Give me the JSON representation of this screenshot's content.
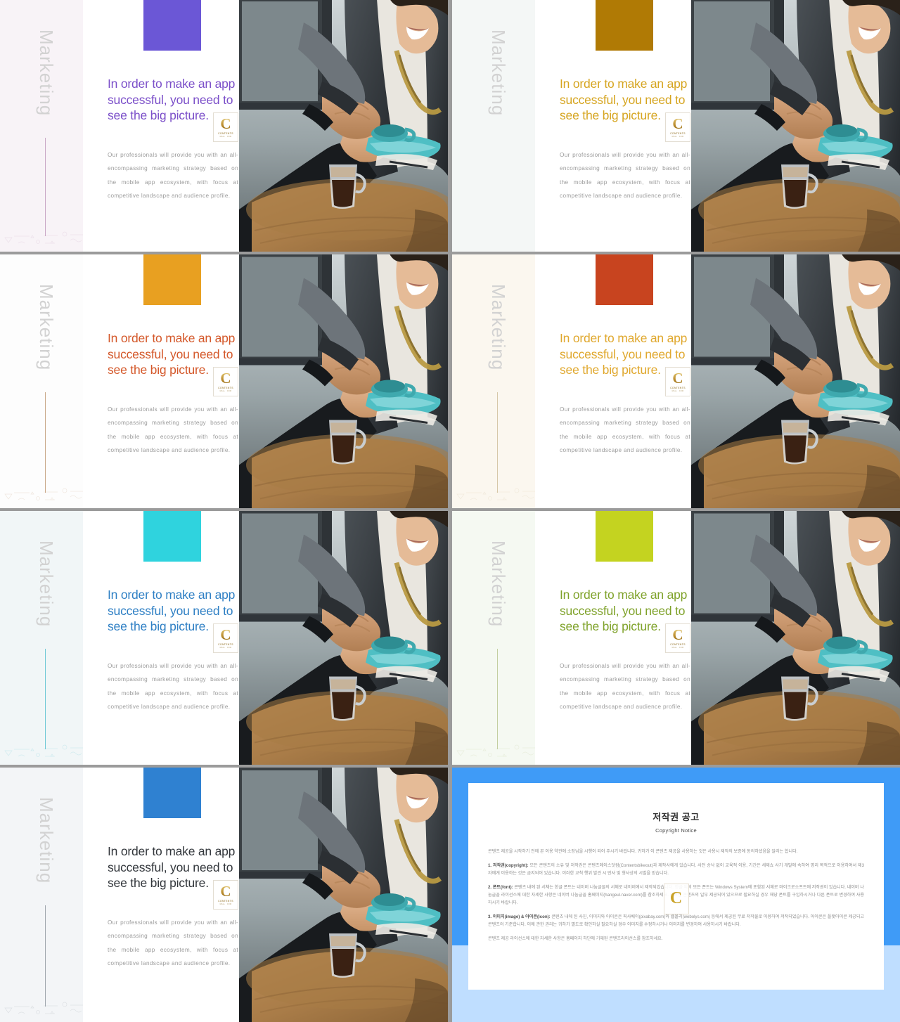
{
  "deck": {
    "slide_count": 8,
    "vertical_label": "Marketing",
    "headline": "In order to make an app successful,  you need to see the big picture.",
    "body": "Our professionals will provide you with an all-encompassing marketing strategy based on the mobile app ecosystem, with focus at competitive landscape and audience profile.",
    "logo": {
      "letter": "C",
      "name": "CONTENTS",
      "tagline": "MALL . COM"
    }
  },
  "slides": [
    {
      "index": 1,
      "accent_hex": "#6B57D6",
      "headline_hex": "#7B4FC9",
      "tint_hex": "#f8f3f7",
      "rule_hex": "#c9a8c6",
      "name": "slide-purple"
    },
    {
      "index": 2,
      "accent_hex": "#B07A05",
      "headline_hex": "#D6A520",
      "tint_hex": "#f4f7f6",
      "rule_hex": "#c7b municipality",
      "name": "slide-gold"
    },
    {
      "index": 3,
      "accent_hex": "#E8A021",
      "headline_hex": "#D4582A",
      "tint_hex": "#fdfdfd",
      "rule_hex": "#c9a98a",
      "name": "slide-orange"
    },
    {
      "index": 4,
      "accent_hex": "#C8441F",
      "headline_hex": "#E0A82E",
      "tint_hex": "#fbf7ef",
      "rule_hex": "#d6c8a8",
      "name": "slide-brick"
    },
    {
      "index": 5,
      "accent_hex": "#2FD3DE",
      "headline_hex": "#2E7FC4",
      "tint_hex": "#f1f6f7",
      "rule_hex": "#6fc9d6",
      "name": "slide-cyan"
    },
    {
      "index": 6,
      "accent_hex": "#C4D320",
      "headline_hex": "#7FA22A",
      "tint_hex": "#f5f9f2",
      "rule_hex": "#c3cfa0",
      "name": "slide-lime"
    },
    {
      "index": 7,
      "accent_hex": "#2F81D1",
      "headline_hex": "#33373C",
      "tint_hex": "#f3f5f7",
      "rule_hex": "#9fa6ad",
      "name": "slide-blue"
    }
  ],
  "copyright": {
    "title": "저작권 공고",
    "subtitle": "Copyright Notice",
    "intro": "콘텐츠 제공을 시작하기 전에 본 이용 약관에 소장님을 시행이 되어 주시기 바랍니다. 귀하가 이 콘텐츠 제공을 사용하는 것은 사용시 제작의 보증에 동의하셨음을 알리는 합니다.",
    "sections": [
      {
        "label": "1. 저작권(copyright):",
        "text": "모든 콘텐츠의 소유 및 저작권은 콘텐츠메이스닷컴(Contentsbikeout)과 제작사에게 있습니다. 사전 승낙 없이 교육적 이용, 기간은 세제쇼 사기 개발에 속하여 영리 목적으로 이용하여서 제3자에게 이용하는 것은 금지되어 있습니다. 이러한 교칙 행위 발견 시 민사 및 형사상의 시벌을 받습니다."
      },
      {
        "label": "2. 폰트(font):",
        "text": "콘텐츠 내에 된 서체는 한글 폰트는 네이버 나눔글꼴의 서체로 네이버에서 제작되었습니다. 한글 외의 모든 폰트는 Windows System에 포함된 서체로 마이크로소프트에 저작권이 있습니다. 네이버 나눔글꼴 라이선스에 대한 자세한 사항은 네이버 나눔글꼴 홈페이지(hangeul.naver.com)를 참조하세요. 폰트는 콘텐츠의 일부 제공되어 있으므로 필요하실 경우 해당 폰트를 구입하시거나 다른 폰트로 변경하여 사용하시기 바랍니다."
      },
      {
        "label": "3. 이미지(image) & 아이콘(icon):",
        "text": "콘텐츠 내에 된 사진, 이미지와 아이콘은 픽사베이(pixabay.com)와 웹볼리(webolys.com) 등에서 제공된 무료 저작물로 이용하여 저작되었습니다. 아이콘은 플랫아이콘 제공되고 콘텐츠의 기준합니다. 이에 관한 권리는 귀하가 별도로 확인하실 필요하실 경우 이미지를 수정하시거나 이미지를 변경하여 사용하시기 바랍니다."
      }
    ],
    "footer": "콘텐츠 제공 라이선스에 대한 자세한 사항은 홈페이지 하단에 기재된 콘텐츠라이선스를 참조하세요.",
    "watermark_letter": "C",
    "border_hex": "#3f9bf7",
    "base_hex": "#bfdeff"
  }
}
